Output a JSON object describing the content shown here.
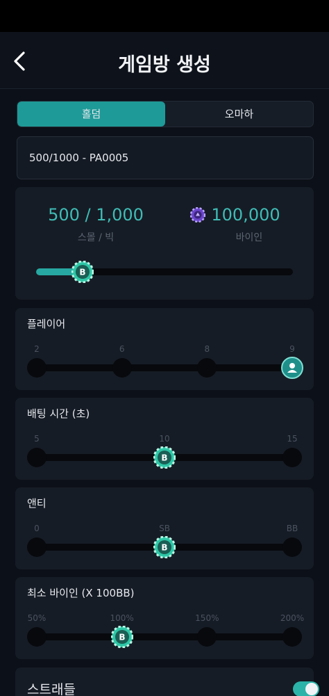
{
  "header": {
    "title": "게임방 생성"
  },
  "tabs": [
    {
      "label": "홀덤",
      "active": true
    },
    {
      "label": "오마하",
      "active": false
    }
  ],
  "blind_select": {
    "value": "500/1000 - PA0005"
  },
  "stakes": {
    "blinds_value": "500 / 1,000",
    "blinds_label": "스몰 / 빅",
    "buyin_value": "100,000",
    "buyin_label": "바이인",
    "slider_level": 0.18
  },
  "players": {
    "label": "플레이어",
    "ticks": [
      "2",
      "6",
      "8",
      "9"
    ],
    "selected_index": 3
  },
  "bet_time": {
    "label": "배팅 시간 (초)",
    "ticks": [
      "5",
      "10",
      "15"
    ],
    "selected_index": 1
  },
  "ante": {
    "label": "앤티",
    "ticks": [
      "0",
      "SB",
      "BB"
    ],
    "selected_index": 1
  },
  "min_buyin": {
    "label": "최소 바이인 (X 100BB)",
    "ticks": [
      "50%",
      "100%",
      "150%",
      "200%"
    ],
    "selected_index": 1
  },
  "straddle": {
    "label": "스트래들",
    "enabled": true
  },
  "colors": {
    "accent": "#1e9a98",
    "accent_text": "#3fbcb6",
    "card_bg": "#161c25",
    "track": "#07090d"
  },
  "icons": {
    "back": "chevron-left-icon",
    "chip": "poker-chip-icon",
    "knob": "chip-b-icon",
    "player": "user-icon"
  }
}
